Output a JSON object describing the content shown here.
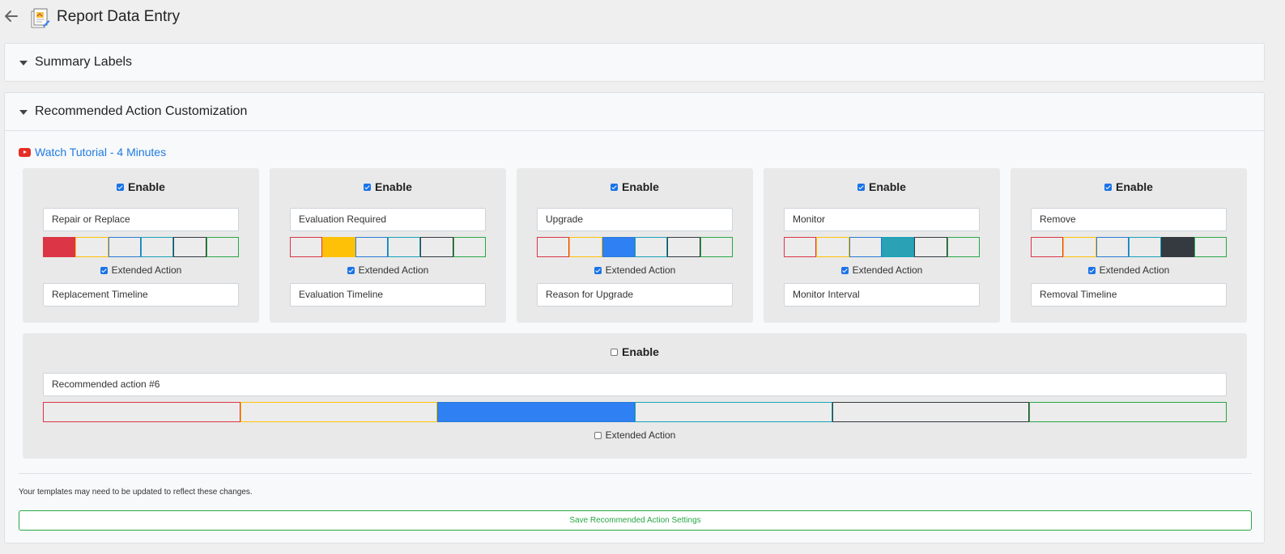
{
  "header": {
    "title": "Report Data Entry"
  },
  "summary_panel": {
    "title": "Summary Labels"
  },
  "action_panel": {
    "title": "Recommended Action Customization",
    "tutorial_link": "Watch Tutorial - 4 Minutes",
    "enable_label": "Enable",
    "extended_label": "Extended Action",
    "swatch_colors": [
      {
        "name": "red",
        "border": "#dc3545",
        "fill": "#dc3545"
      },
      {
        "name": "yellow",
        "border": "#ffc107",
        "fill": "#ffc107"
      },
      {
        "name": "blue",
        "border": "#2a7bd4",
        "fill": "#2f80f3"
      },
      {
        "name": "teal",
        "border": "#17a2b8",
        "fill": "#2aa1b5"
      },
      {
        "name": "dark",
        "border": "#343a40",
        "fill": "#343a40"
      },
      {
        "name": "green",
        "border": "#28a745",
        "fill": "#28a745"
      }
    ],
    "actions": [
      {
        "enabled": true,
        "name": "Repair or Replace",
        "selected_color": 0,
        "extended": true,
        "extended_text": "Replacement Timeline"
      },
      {
        "enabled": true,
        "name": "Evaluation Required",
        "selected_color": 1,
        "extended": true,
        "extended_text": "Evaluation Timeline"
      },
      {
        "enabled": true,
        "name": "Upgrade",
        "selected_color": 2,
        "extended": true,
        "extended_text": "Reason for Upgrade"
      },
      {
        "enabled": true,
        "name": "Monitor",
        "selected_color": 3,
        "extended": true,
        "extended_text": "Monitor Interval"
      },
      {
        "enabled": true,
        "name": "Remove",
        "selected_color": 4,
        "extended": true,
        "extended_text": "Removal Timeline"
      },
      {
        "enabled": false,
        "name": "Recommended action #6",
        "selected_color": 2,
        "extended": false,
        "extended_text": ""
      }
    ],
    "note": "Your templates may need to be updated to reflect these changes.",
    "save_label": "Save Recommended Action Settings"
  }
}
